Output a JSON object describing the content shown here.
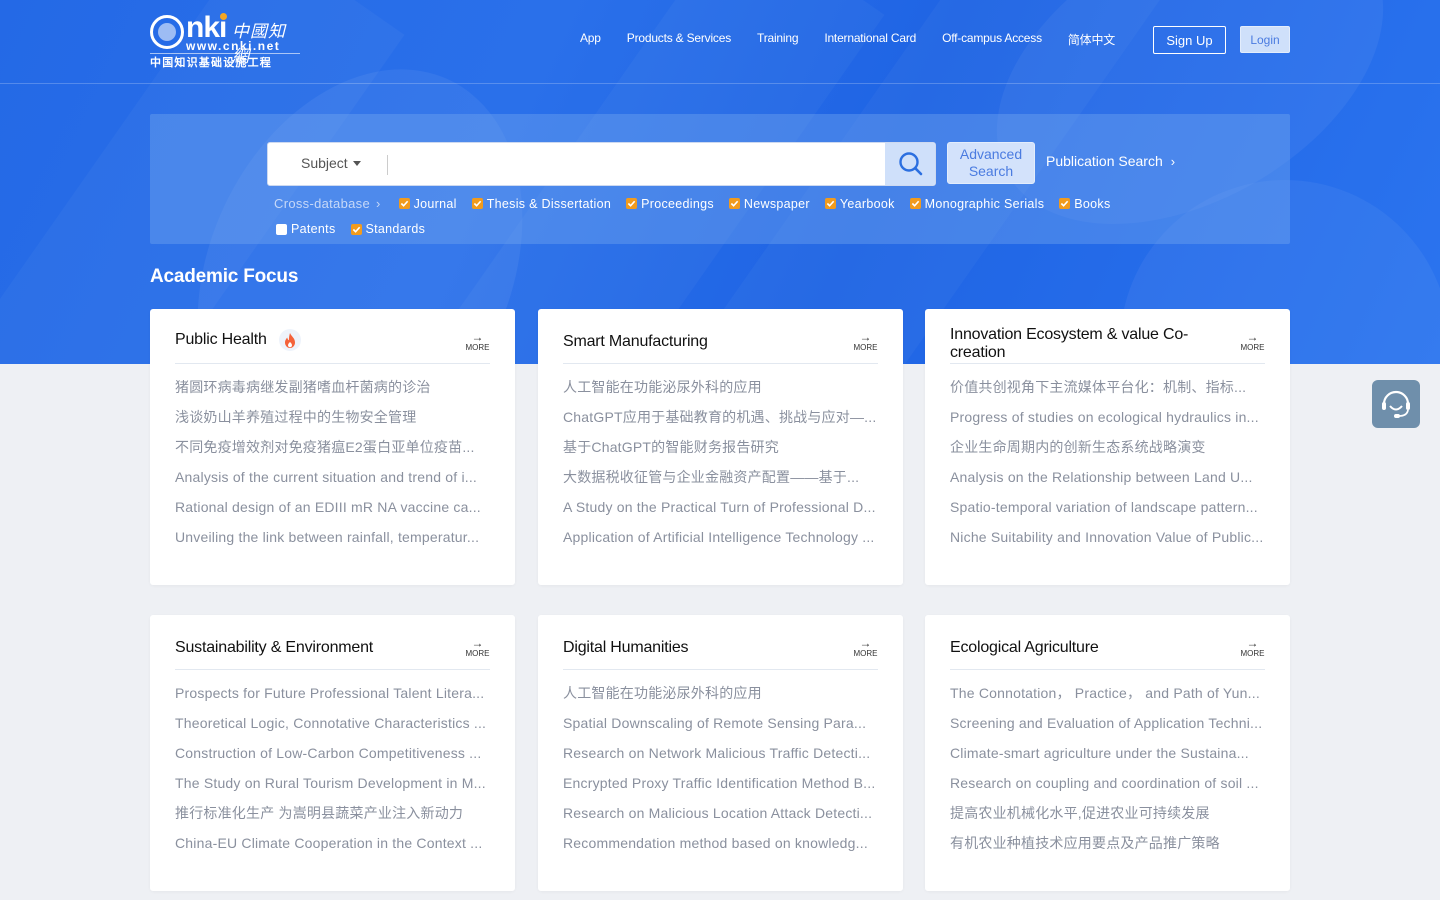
{
  "header": {
    "logo": {
      "brand": "nki",
      "brand_cn": "中國知網",
      "url": "www.cnki.net",
      "subtitle": "中国知识基础设施工程"
    },
    "nav": [
      "App",
      "Products & Services",
      "Training",
      "International Card",
      "Off-campus Access",
      "简体中文"
    ],
    "sign_up": "Sign Up",
    "login": "Login"
  },
  "search": {
    "field": "Subject",
    "query": "",
    "placeholder": "",
    "advanced": "Advanced Search",
    "publication_search": "Publication Search",
    "cross_database": "Cross-database",
    "databases": [
      {
        "label": "Journal",
        "checked": true
      },
      {
        "label": "Thesis & Dissertation",
        "checked": true
      },
      {
        "label": "Proceedings",
        "checked": true
      },
      {
        "label": "Newspaper",
        "checked": true
      },
      {
        "label": "Yearbook",
        "checked": true
      },
      {
        "label": "Monographic Serials",
        "checked": true
      },
      {
        "label": "Books",
        "checked": true
      },
      {
        "label": "Patents",
        "checked": false
      },
      {
        "label": "Standards",
        "checked": true
      }
    ]
  },
  "colors": {
    "brand_blue": "#2469e6",
    "checkbox_orange": "#f19b1e",
    "hot_icon": "#f4623a"
  },
  "academic_focus": {
    "title": "Academic Focus",
    "more_label": "MORE",
    "cards": [
      {
        "title": "Public Health",
        "hot": true,
        "items": [
          "猪圆环病毒病继发副猪嗜血杆菌病的诊治",
          "浅谈奶山羊养殖过程中的生物安全管理",
          "不同免疫增效剂对免疫猪瘟E2蛋白亚单位疫苗...",
          "Analysis of the current situation and trend of i...",
          "Rational design of an EDIII mR NA vaccine ca...",
          "Unveiling the link between rainfall, temperatur..."
        ]
      },
      {
        "title": "Smart Manufacturing",
        "hot": false,
        "items": [
          "人工智能在功能泌尿外科的应用",
          "ChatGPT应用于基础教育的机遇、挑战与应对—...",
          "基于ChatGPT的智能财务报告研究",
          "大数据税收征管与企业金融资产配置——基于...",
          "A Study on the Practical Turn of Professional D...",
          "Application of Artificial Intelligence Technology ..."
        ]
      },
      {
        "title": "Innovation Ecosystem & value Co-creation",
        "hot": false,
        "items": [
          "价值共创视角下主流媒体平台化：机制、指标...",
          "Progress of studies on ecological hydraulics in...",
          "企业生命周期内的创新生态系统战略演变",
          "Analysis on the Relationship between Land U...",
          "Spatio-temporal variation of landscape pattern...",
          "Niche Suitability and Innovation Value of Public..."
        ]
      },
      {
        "title": "Sustainability & Environment",
        "hot": false,
        "items": [
          "Prospects for Future Professional Talent Litera...",
          "Theoretical Logic, Connotative Characteristics ...",
          "Construction of Low-Carbon Competitiveness ...",
          "The Study on Rural Tourism Development in M...",
          "推行标准化生产 为嵩明县蔬菜产业注入新动力",
          "China-EU Climate Cooperation in the Context ..."
        ]
      },
      {
        "title": "Digital Humanities",
        "hot": false,
        "items": [
          "人工智能在功能泌尿外科的应用",
          "Spatial Downscaling of Remote Sensing Para...",
          "Research on Network Malicious Traffic Detecti...",
          "Encrypted Proxy Traffic Identification Method B...",
          "Research on Malicious Location Attack Detecti...",
          "Recommendation method based on knowledg..."
        ]
      },
      {
        "title": "Ecological Agriculture",
        "hot": false,
        "items": [
          "The Connotation， Practice， and Path of Yun...",
          "Screening and Evaluation of Application Techni...",
          "Climate-smart agriculture under the Sustaina...",
          "Research on coupling and coordination of soil ...",
          "提高农业机械化水平,促进农业可持续发展",
          "有机农业种植技术应用要点及产品推广策略"
        ]
      }
    ]
  },
  "support": {
    "icon": "headset-icon"
  }
}
